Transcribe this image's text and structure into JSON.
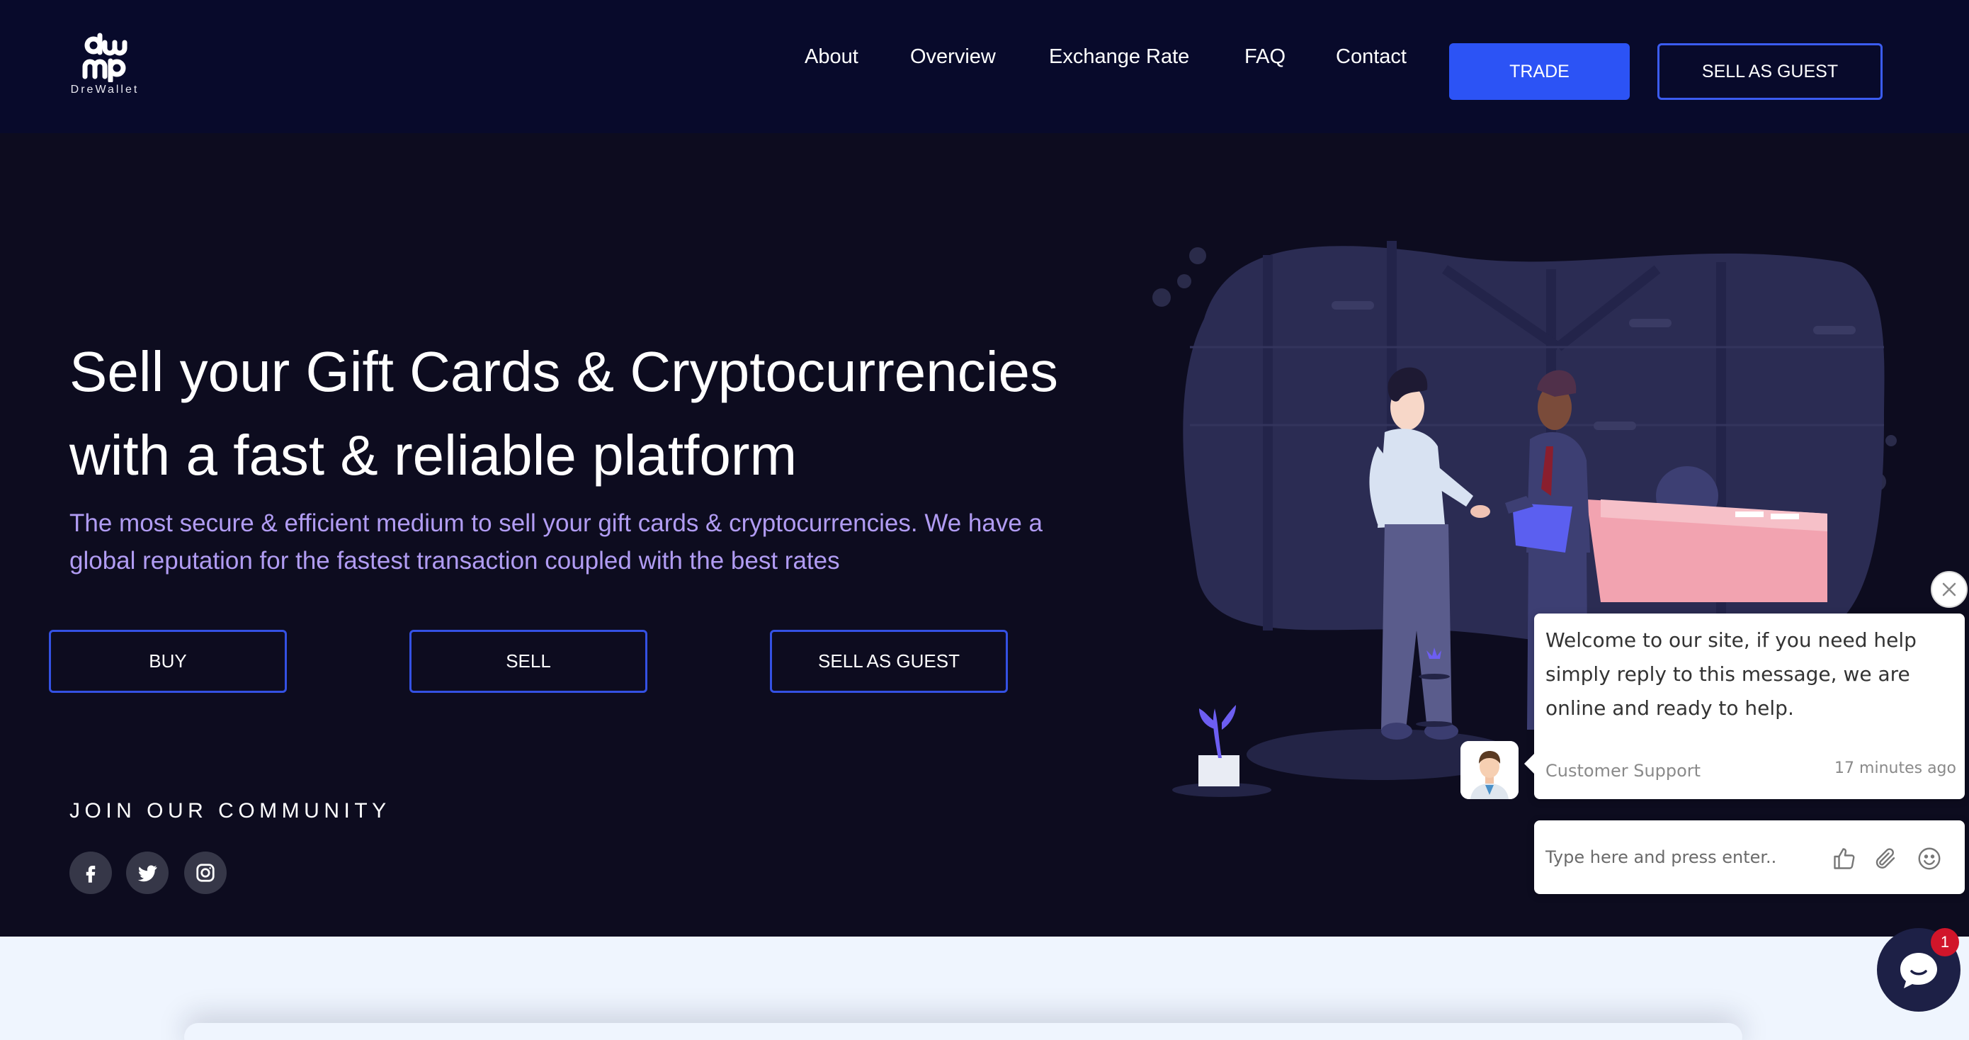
{
  "brand": {
    "logo_text": "DreWallet"
  },
  "nav": {
    "items": [
      {
        "label": "About"
      },
      {
        "label": "Overview"
      },
      {
        "label": "Exchange Rate"
      },
      {
        "label": "FAQ"
      },
      {
        "label": "Contact"
      }
    ],
    "trade_label": "TRADE",
    "sell_guest_label": "SELL AS GUEST"
  },
  "hero": {
    "title_line1": "Sell your Gift Cards & Cryptocurrencies",
    "title_line2": "with a fast & reliable platform",
    "subtitle": "The most secure & efficient medium to sell your gift cards & cryptocurrencies. We have a global reputation for the fastest transaction coupled with the best rates",
    "buttons": {
      "buy": "BUY",
      "sell": "SELL",
      "sell_guest": "SELL AS GUEST"
    }
  },
  "community": {
    "heading": "JOIN OUR COMMUNITY",
    "icons": [
      "facebook-icon",
      "twitter-icon",
      "instagram-icon"
    ]
  },
  "chat": {
    "message": "Welcome to our site, if you need help simply reply to this message, we are online and ready to help.",
    "sender": "Customer Support",
    "time": "17 minutes ago",
    "input_placeholder": "Type here and press enter..",
    "unread_count": "1"
  },
  "colors": {
    "header_bg": "#080a2b",
    "page_bg": "#0d0c1f",
    "accent_blue": "#2c53f5",
    "subtitle_purple": "#b19cf3",
    "bottom_band": "#eff5fe",
    "badge_red": "#d1152a"
  }
}
